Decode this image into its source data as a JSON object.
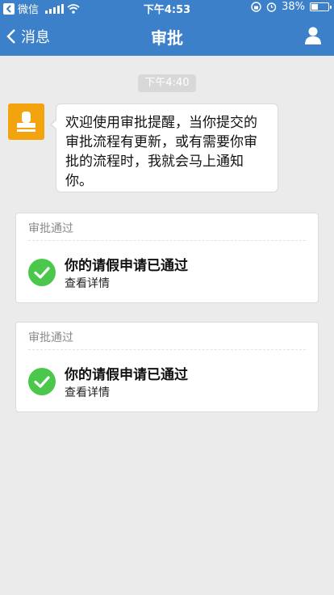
{
  "status_bar": {
    "back_app": "微信",
    "time": "下午4:53",
    "battery": "38%",
    "battery_level": 0.38
  },
  "nav": {
    "back_label": "消息",
    "title": "审批"
  },
  "chat": {
    "timestamp": "下午4:40",
    "welcome_message": "欢迎使用审批提醒，当你提交的审批流程有更新，或有需要你审批的流程时，我就会马上通知你。"
  },
  "cards": [
    {
      "header": "审批通过",
      "title": "你的请假申请已通过",
      "link": "查看详情"
    },
    {
      "header": "审批通过",
      "title": "你的请假申请已通过",
      "link": "查看详情"
    }
  ],
  "colors": {
    "header": "#3c80c9",
    "avatar": "#f3a30d",
    "success": "#4bc74b",
    "background": "#ebebeb"
  },
  "icons": [
    "chevron-left-icon",
    "wifi-icon",
    "signal-icon",
    "alarm-icon",
    "orientation-lock-icon",
    "battery-icon",
    "user-icon",
    "stamp-icon",
    "check-circle-icon"
  ]
}
